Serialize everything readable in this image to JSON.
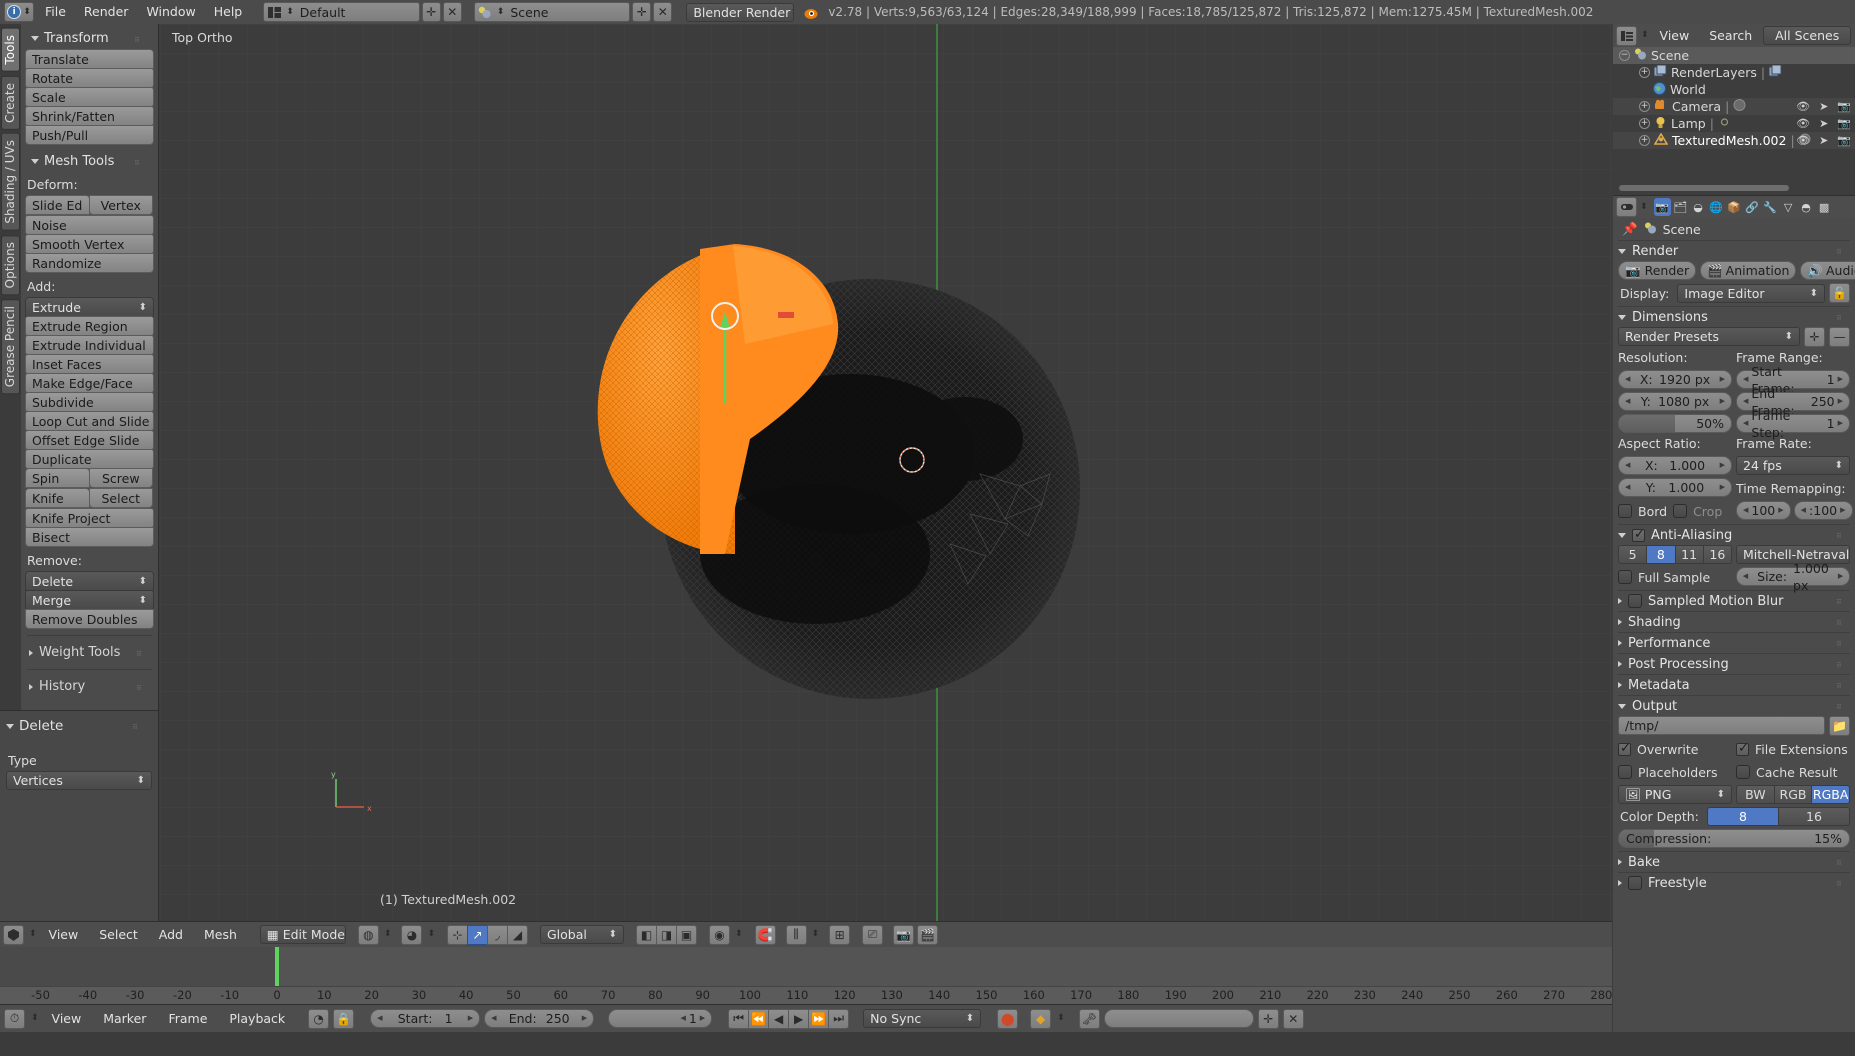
{
  "topbar": {
    "menus": [
      "File",
      "Render",
      "Window",
      "Help"
    ],
    "screen_layout": "Default",
    "scene": "Scene",
    "engine": "Blender Render",
    "stats": "v2.78 | Verts:9,563/63,124 | Edges:28,349/188,999 | Faces:18,785/125,872 | Tris:125,872 | Mem:1275.45M | TexturedMesh.002"
  },
  "toolshelf": {
    "tabs": [
      "Tools",
      "Create",
      "Shading / UVs",
      "Options",
      "Grease Pencil"
    ],
    "active_tab": "Tools",
    "transform": {
      "title": "Transform",
      "buttons": [
        "Translate",
        "Rotate",
        "Scale",
        "Shrink/Fatten",
        "Push/Pull"
      ]
    },
    "mesh_tools": {
      "title": "Mesh Tools",
      "deform_label": "Deform:",
      "deform": [
        "Slide Ed",
        "Vertex",
        "Noise",
        "Smooth Vertex",
        "Randomize"
      ],
      "add_label": "Add:",
      "add_dropdown": "Extrude",
      "add": [
        "Extrude Region",
        "Extrude Individual",
        "Inset Faces",
        "Make Edge/Face",
        "Subdivide",
        "Loop Cut and Slide",
        "Offset Edge Slide",
        "Duplicate"
      ],
      "add_pairs": [
        [
          "Spin",
          "Screw"
        ],
        [
          "Knife",
          "Select"
        ]
      ],
      "add_tail": [
        "Knife Project",
        "Bisect"
      ],
      "remove_label": "Remove:",
      "remove_dropdowns": [
        "Delete",
        "Merge"
      ],
      "remove_buttons": [
        "Remove Doubles"
      ]
    },
    "collapsed_panels": [
      "Weight Tools",
      "History"
    ]
  },
  "operator_panel": {
    "title": "Delete",
    "field_label": "Type",
    "field_value": "Vertices"
  },
  "viewport": {
    "view_label": "Top Ortho",
    "object_label": "(1) TexturedMesh.002",
    "axis_x": "x",
    "axis_y": "y",
    "selection_color": "#ff8b1f",
    "grid_color": "#3c3c3c"
  },
  "view_header": {
    "menus": [
      "View",
      "Select",
      "Add",
      "Mesh"
    ],
    "mode": "Edit Mode",
    "orientation": "Global",
    "select_modes": [
      "vertex-select-icon",
      "edge-select-icon",
      "face-select-icon"
    ],
    "pivot": "pivot-icon",
    "snap": "magnet-icon",
    "proportional": "proportional-edit-icon"
  },
  "timeline": {
    "menus": [
      "View",
      "Marker",
      "Frame",
      "Playback"
    ],
    "start_label": "Start:",
    "start_value": "1",
    "end_label": "End:",
    "end_value": "250",
    "current_frame": "1",
    "sync_mode": "No Sync",
    "ruler_ticks": [
      "-50",
      "-40",
      "-30",
      "-20",
      "-10",
      "0",
      "10",
      "20",
      "30",
      "40",
      "50",
      "60",
      "70",
      "80",
      "90",
      "100",
      "110",
      "120",
      "130",
      "140",
      "150",
      "160",
      "170",
      "180",
      "190",
      "200",
      "210",
      "220",
      "230",
      "240",
      "250",
      "260",
      "270",
      "280"
    ],
    "playhead_frame": "0"
  },
  "outliner": {
    "header_menus": [
      "View",
      "Search"
    ],
    "filter": "All Scenes",
    "rows": [
      {
        "label": "Scene",
        "icon": "scene-icon",
        "depth": 0,
        "expander": "minus",
        "selected": true,
        "icons": []
      },
      {
        "label": "RenderLayers",
        "icon": "renderlayers-icon",
        "depth": 1,
        "expander": "plus",
        "selected": false,
        "icons": []
      },
      {
        "label": "World",
        "icon": "world-icon",
        "depth": 1,
        "expander": "",
        "selected": false,
        "icons": []
      },
      {
        "label": "Camera",
        "icon": "camera-icon",
        "depth": 1,
        "expander": "plus",
        "selected": false,
        "icons": [
          "eye",
          "cursor",
          "camera"
        ]
      },
      {
        "label": "Lamp",
        "icon": "lamp-icon",
        "depth": 1,
        "expander": "plus",
        "selected": false,
        "icons": [
          "eye",
          "cursor",
          "camera"
        ]
      },
      {
        "label": "TexturedMesh.002",
        "icon": "mesh-icon",
        "depth": 1,
        "expander": "plus",
        "selected": false,
        "icons": [
          "eye",
          "cursor",
          "camera"
        ]
      }
    ]
  },
  "properties": {
    "tabs": [
      "render-tab",
      "renderlayers-tab",
      "scene-tab",
      "world-tab",
      "object-tab",
      "constraints-tab",
      "modifiers-tab",
      "data-tab",
      "material-tab",
      "texture-tab"
    ],
    "active_tab_index": 0,
    "breadcrumb": "Scene",
    "render": {
      "title": "Render",
      "buttons": [
        "Render",
        "Animation",
        "Audio"
      ],
      "display_label": "Display:",
      "display_value": "Image Editor"
    },
    "dimensions": {
      "title": "Dimensions",
      "presets": "Render Presets",
      "resolution_label": "Resolution:",
      "res_x_label": "X:",
      "res_x": "1920 px",
      "res_y_label": "Y:",
      "res_y": "1080 px",
      "res_percent": "50%",
      "frame_range_label": "Frame Range:",
      "start_frame_label": "Start Frame:",
      "start_frame": "1",
      "end_frame_label": "End Frame:",
      "end_frame": "250",
      "frame_step_label": "Frame Step:",
      "frame_step": "1",
      "aspect_label": "Aspect Ratio:",
      "aspect_x_label": "X:",
      "aspect_x": "1.000",
      "aspect_y_label": "Y:",
      "aspect_y": "1.000",
      "frame_rate_label": "Frame Rate:",
      "frame_rate": "24 fps",
      "time_remap_label": "Time Remapping:",
      "remap_old": "100",
      "remap_new": ":100",
      "border_label": "Bord",
      "crop_label": "Crop"
    },
    "antialiasing": {
      "title": "Anti-Aliasing",
      "enabled": true,
      "samples": [
        "5",
        "8",
        "11",
        "16"
      ],
      "active_sample": "8",
      "filter": "Mitchell-Netravali",
      "full_sample_label": "Full Sample",
      "size_label": "Size:",
      "size_value": "1.000 px"
    },
    "collapsed": [
      {
        "title": "Sampled Motion Blur",
        "checkbox": true
      },
      {
        "title": "Shading",
        "checkbox": false
      },
      {
        "title": "Performance",
        "checkbox": false
      },
      {
        "title": "Post Processing",
        "checkbox": false
      },
      {
        "title": "Metadata",
        "checkbox": false
      }
    ],
    "output": {
      "title": "Output",
      "path": "/tmp/",
      "overwrite_label": "Overwrite",
      "overwrite": true,
      "file_ext_label": "File Extensions",
      "file_ext": true,
      "placeholders_label": "Placeholders",
      "placeholders": false,
      "cache_label": "Cache Result",
      "cache": false,
      "format": "PNG",
      "channels": [
        "BW",
        "RGB",
        "RGBA"
      ],
      "active_channel": "RGBA",
      "color_depth_label": "Color Depth:",
      "depths": [
        "8",
        "16"
      ],
      "active_depth": "8",
      "compression_label": "Compression:",
      "compression_value": "15%"
    },
    "tail_panels": [
      {
        "title": "Bake",
        "checkbox": false
      },
      {
        "title": "Freestyle",
        "checkbox": true
      }
    ]
  },
  "colors": {
    "accent_blue": "#4f79c4",
    "selection_orange": "#ff8b1f",
    "panel_bg": "#4b4b4b",
    "viewport_bg": "#3c3c3c"
  }
}
